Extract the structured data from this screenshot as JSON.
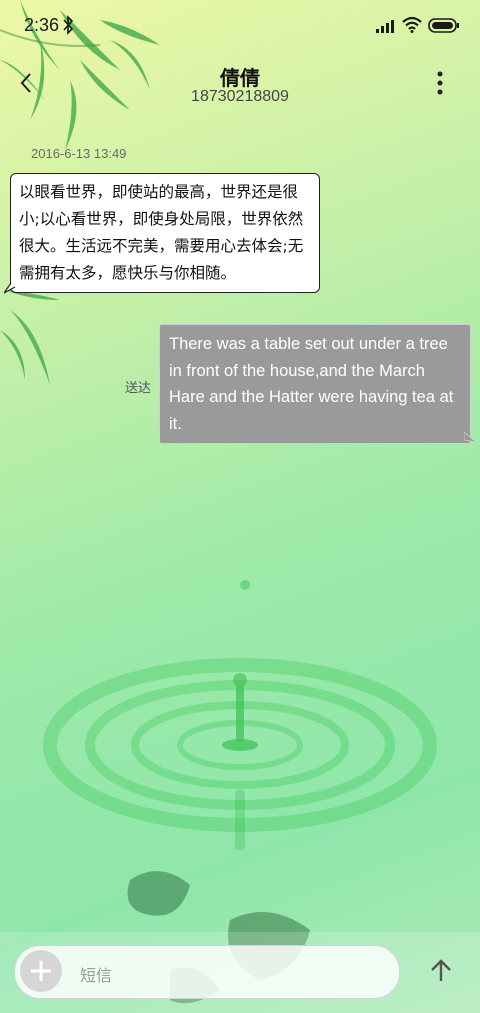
{
  "status_bar": {
    "time": "2:36"
  },
  "header": {
    "contact_name": "倩倩",
    "contact_number": "18730218809"
  },
  "conversation": {
    "timestamp": "2016-6-13 13:49",
    "messages": [
      {
        "direction": "incoming",
        "text": "以眼看世界，即使站的最高，世界还是很小;以心看世界，即使身处局限，世界依然很大。生活远不完美，需要用心去体会;无需拥有太多，愿快乐与你相随。"
      },
      {
        "direction": "outgoing",
        "text": "There was a table set out under a tree in front of the house,and the March Hare and the Hatter were having tea at it.",
        "status": "送达"
      }
    ]
  },
  "composer": {
    "placeholder": "短信"
  },
  "icons": {
    "back": "back-arrow-icon",
    "more": "more-vertical-icon",
    "add": "plus-icon",
    "send": "send-arrow-icon",
    "bluetooth": "bluetooth-icon",
    "signal": "signal-icon",
    "wifi": "wifi-icon",
    "battery": "battery-icon"
  },
  "colors": {
    "incoming_bubble": "#ffffff",
    "outgoing_bubble": "#9a9a9a",
    "background_top": "#eef8a6",
    "background_bottom": "#8fe6ab"
  }
}
